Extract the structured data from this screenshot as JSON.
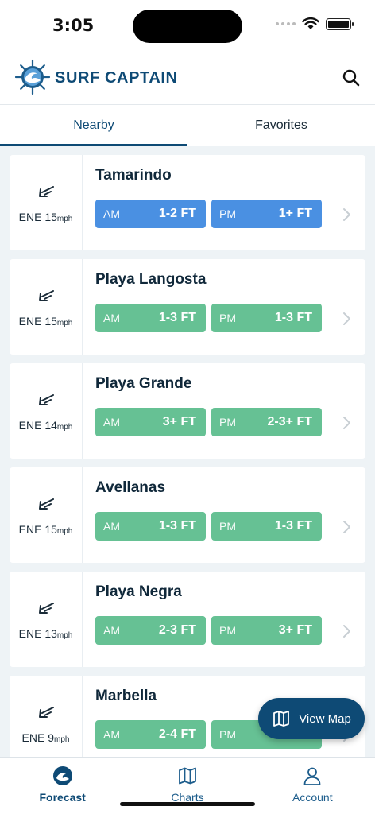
{
  "status": {
    "time": "3:05"
  },
  "header": {
    "brand": "SURF CAPTAIN"
  },
  "tabs": [
    {
      "label": "Nearby",
      "active": true
    },
    {
      "label": "Favorites",
      "active": false
    }
  ],
  "spots": [
    {
      "name": "Tamarindo",
      "wind_dir": "ENE",
      "wind_speed": "15",
      "wind_unit": "mph",
      "am_label": "AM",
      "am": "1-2 FT",
      "pm_label": "PM",
      "pm": "1+ FT",
      "color": "#4a90e2"
    },
    {
      "name": "Playa Langosta",
      "wind_dir": "ENE",
      "wind_speed": "15",
      "wind_unit": "mph",
      "am_label": "AM",
      "am": "1-3 FT",
      "pm_label": "PM",
      "pm": "1-3 FT",
      "color": "#66c194"
    },
    {
      "name": "Playa Grande",
      "wind_dir": "ENE",
      "wind_speed": "14",
      "wind_unit": "mph",
      "am_label": "AM",
      "am": "3+ FT",
      "pm_label": "PM",
      "pm": "2-3+ FT",
      "color": "#66c194"
    },
    {
      "name": "Avellanas",
      "wind_dir": "ENE",
      "wind_speed": "15",
      "wind_unit": "mph",
      "am_label": "AM",
      "am": "1-3 FT",
      "pm_label": "PM",
      "pm": "1-3 FT",
      "color": "#66c194"
    },
    {
      "name": "Playa Negra",
      "wind_dir": "ENE",
      "wind_speed": "13",
      "wind_unit": "mph",
      "am_label": "AM",
      "am": "2-3 FT",
      "pm_label": "PM",
      "pm": "3+ FT",
      "color": "#66c194"
    },
    {
      "name": "Marbella",
      "wind_dir": "ENE",
      "wind_speed": "9",
      "wind_unit": "mph",
      "am_label": "AM",
      "am": "2-4 FT",
      "pm_label": "PM",
      "pm": "",
      "color": "#66c194"
    }
  ],
  "fab": {
    "label": "View Map"
  },
  "nav": [
    {
      "label": "Forecast",
      "icon": "wave-icon",
      "active": true
    },
    {
      "label": "Charts",
      "icon": "map-icon",
      "active": false
    },
    {
      "label": "Account",
      "icon": "user-icon",
      "active": false
    }
  ],
  "colors": {
    "brand": "#0e4a75",
    "blue_pill": "#4a90e2",
    "green_pill": "#66c194"
  }
}
